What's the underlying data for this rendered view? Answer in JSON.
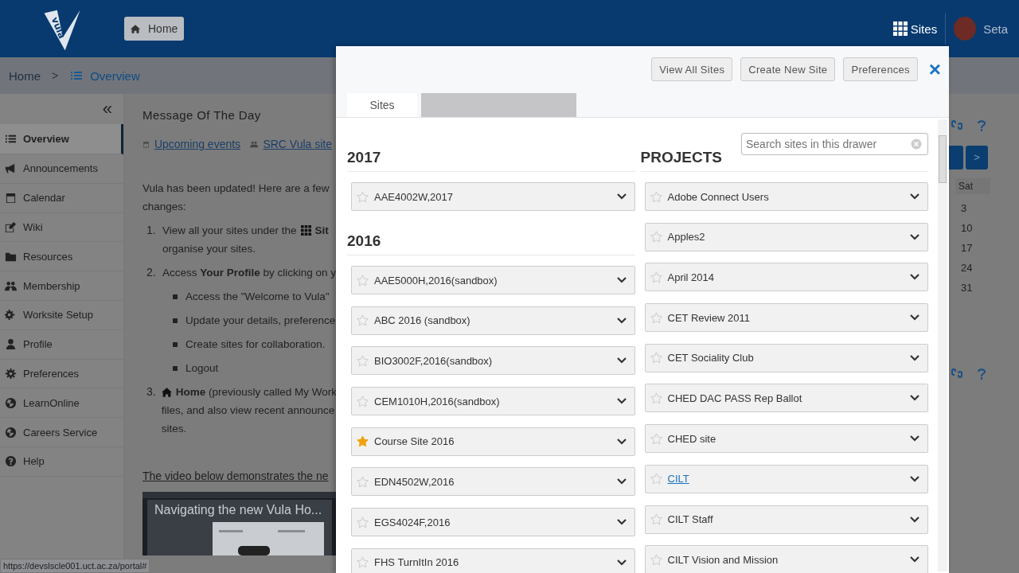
{
  "header": {
    "logo_text": "vula",
    "home_button": "Home",
    "sites_button": "Sites",
    "user_name": "Seta"
  },
  "breadcrumb": {
    "home": "Home",
    "separator": ">",
    "current": "Overview"
  },
  "sidebar": {
    "collapse": "«",
    "items": [
      {
        "label": "Overview",
        "selected": true
      },
      {
        "label": "Announcements",
        "selected": false
      },
      {
        "label": "Calendar",
        "selected": false
      },
      {
        "label": "Wiki",
        "selected": false
      },
      {
        "label": "Resources",
        "selected": false
      },
      {
        "label": "Membership",
        "selected": false
      },
      {
        "label": "Worksite Setup",
        "selected": false
      },
      {
        "label": "Profile",
        "selected": false
      },
      {
        "label": "Preferences",
        "selected": false
      },
      {
        "label": "LearnOnline",
        "selected": false
      },
      {
        "label": "Careers Service",
        "selected": false
      },
      {
        "label": "Help",
        "selected": false
      }
    ]
  },
  "message": {
    "title": "Message Of The Day",
    "links": [
      "Upcoming events",
      "SRC Vula site"
    ],
    "intro": [
      "Vula has been updated! Here are a few",
      "changes:"
    ],
    "steps": [
      {
        "number": "1.",
        "lines": [
          "View all your sites under the",
          "organise your sites."
        ],
        "bold_tail": "Sit"
      },
      {
        "number": "2.",
        "lines": [
          "Access **Your Profile** by clicking on y"
        ],
        "bullets": [
          "Access the \"Welcome to Vula\"",
          "Update your details, preference",
          "Create sites for collaboration.",
          "Logout"
        ]
      },
      {
        "number": "3.",
        "lines": [
          "**Home** (previously called My Work",
          "files, and also view recent announce",
          "sites."
        ]
      }
    ],
    "video_note": "The video below demonstrates the ne",
    "video_title": "Navigating the new Vula Ho..."
  },
  "calendar": {
    "next": ">",
    "day_header": "Sat",
    "days": [
      "3",
      "10",
      "17",
      "24",
      "31"
    ]
  },
  "status_url": "https://devslscle001.uct.ac.za/portal#",
  "drawer": {
    "buttons": [
      "View All Sites",
      "Create New Site",
      "Preferences"
    ],
    "close": "×",
    "tabs": [
      {
        "label": "Sites",
        "selected": true
      },
      {
        "selected": false
      }
    ],
    "search": {
      "placeholder": "Search sites in this drawer"
    },
    "left_groups": [
      {
        "title": "2017",
        "sites": [
          {
            "name": "AAE4002W,2017",
            "favorite": false,
            "hovered": false
          }
        ]
      },
      {
        "title": "2016",
        "sites": [
          {
            "name": "AAE5000H,2016(sandbox)",
            "favorite": false,
            "hovered": false
          },
          {
            "name": "ABC 2016 (sandbox)",
            "favorite": false,
            "hovered": false
          },
          {
            "name": "BIO3002F,2016(sandbox)",
            "favorite": false,
            "hovered": false
          },
          {
            "name": "CEM1010H,2016(sandbox)",
            "favorite": false,
            "hovered": false
          },
          {
            "name": "Course Site 2016",
            "favorite": true,
            "hovered": false
          },
          {
            "name": "EDN4502W,2016",
            "favorite": false,
            "hovered": false
          },
          {
            "name": "EGS4024F,2016",
            "favorite": false,
            "hovered": false
          },
          {
            "name": "FHS TurnItIn 2016",
            "favorite": false,
            "hovered": false
          }
        ]
      }
    ],
    "right_groups": [
      {
        "title": "PROJECTS",
        "sites": [
          {
            "name": "Adobe Connect Users",
            "favorite": false,
            "hovered": false
          },
          {
            "name": "Apples2",
            "favorite": false,
            "hovered": false
          },
          {
            "name": "April 2014",
            "favorite": false,
            "hovered": false
          },
          {
            "name": "CET Review 2011",
            "favorite": false,
            "hovered": false
          },
          {
            "name": "CET Sociality Club",
            "favorite": false,
            "hovered": false
          },
          {
            "name": "CHED DAC PASS Rep Ballot",
            "favorite": false,
            "hovered": false
          },
          {
            "name": "CHED site",
            "favorite": false,
            "hovered": false
          },
          {
            "name": "CILT",
            "favorite": false,
            "hovered": true
          },
          {
            "name": "CILT Staff",
            "favorite": false,
            "hovered": false
          },
          {
            "name": "CILT Vision and Mission",
            "favorite": false,
            "hovered": false
          }
        ]
      }
    ]
  }
}
